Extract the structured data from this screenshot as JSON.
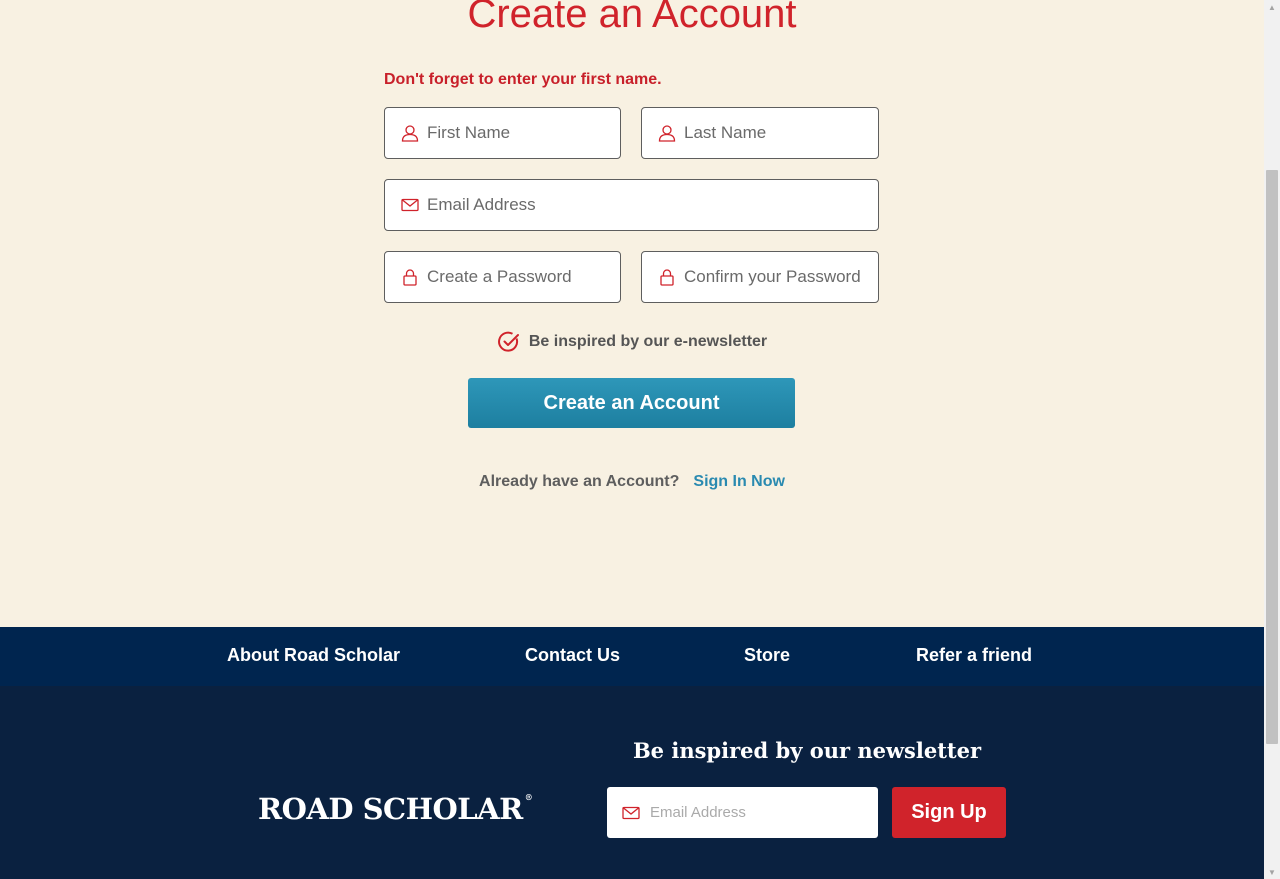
{
  "form": {
    "title": "Create an Account",
    "error": "Don't forget to enter your first name.",
    "first_name_placeholder": "First Name",
    "last_name_placeholder": "Last Name",
    "email_placeholder": "Email Address",
    "password_placeholder": "Create a Password",
    "confirm_password_placeholder": "Confirm your Password",
    "newsletter_label": "Be inspired by our e-newsletter",
    "newsletter_checked": true,
    "submit_label": "Create an Account",
    "already_text": "Already have an Account?",
    "sign_in_label": "Sign In Now"
  },
  "footer_nav": {
    "about": "About Road Scholar",
    "contact": "Contact Us",
    "store": "Store",
    "refer": "Refer a friend"
  },
  "footer": {
    "logo": "ROAD SCHOLAR",
    "logo_mark": "®",
    "newsletter_title": "Be inspired by our newsletter",
    "email_placeholder": "Email Address",
    "signup_label": "Sign Up"
  },
  "icons": {
    "name_fields": "user-icon",
    "email_fields": "envelope-icon",
    "password_fields": "lock-icon",
    "newsletter_check": "check-circle-icon"
  },
  "colors": {
    "page_background": "#f8f1e2",
    "brand_red": "#d0232b",
    "cta_blue": "#2a8ab0",
    "footer_nav_navy": "#00254f",
    "footer_navy": "#0a2140"
  }
}
